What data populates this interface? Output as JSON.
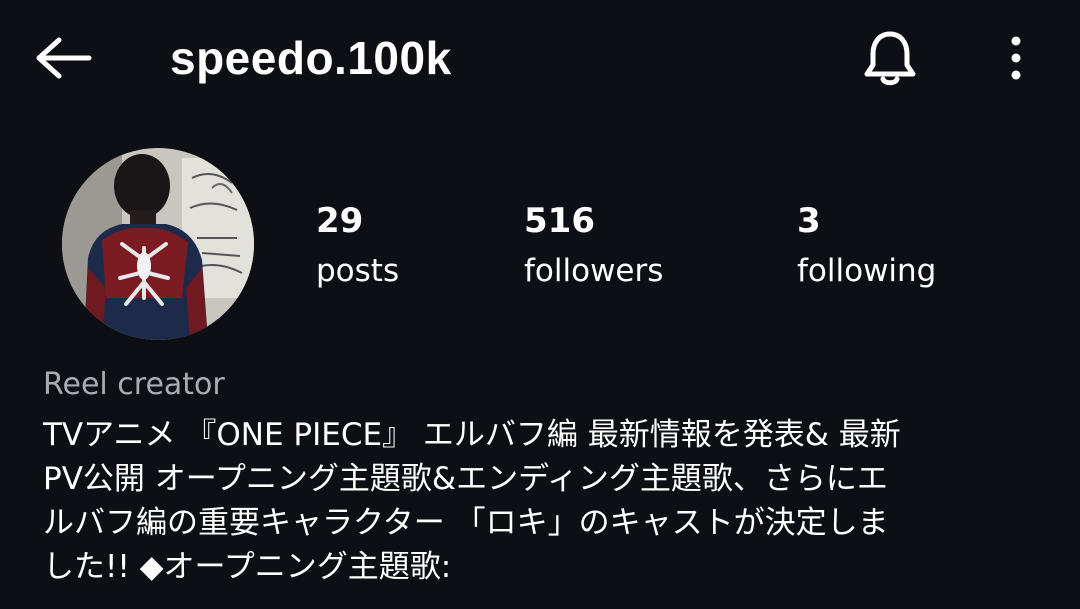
{
  "header": {
    "back_icon": "arrow-left-icon",
    "username": "speedo.100k",
    "notification_icon": "bell-icon",
    "more_icon": "more-vertical-icon"
  },
  "profile": {
    "avatar_icon": "profile-avatar",
    "stats": [
      {
        "count": "29",
        "label": "posts"
      },
      {
        "count": "516",
        "label": "followers"
      },
      {
        "count": "3",
        "label": "following"
      }
    ],
    "category": "Reel creator",
    "bio_lines": [
      "TVアニメ 『ONE PIECE』 エルバフ編 最新情報を発表& 最新",
      "PV公開 オープニング主題歌&エンディング主題歌、さらにエ",
      "ルバフ編の重要キャラクター 「ロキ」のキャストが決定しま",
      "した!! ◆オープニング主題歌:"
    ]
  },
  "colors": {
    "background": "#0d0f14",
    "text_primary": "#ffffff",
    "text_secondary": "#a9acb3"
  }
}
